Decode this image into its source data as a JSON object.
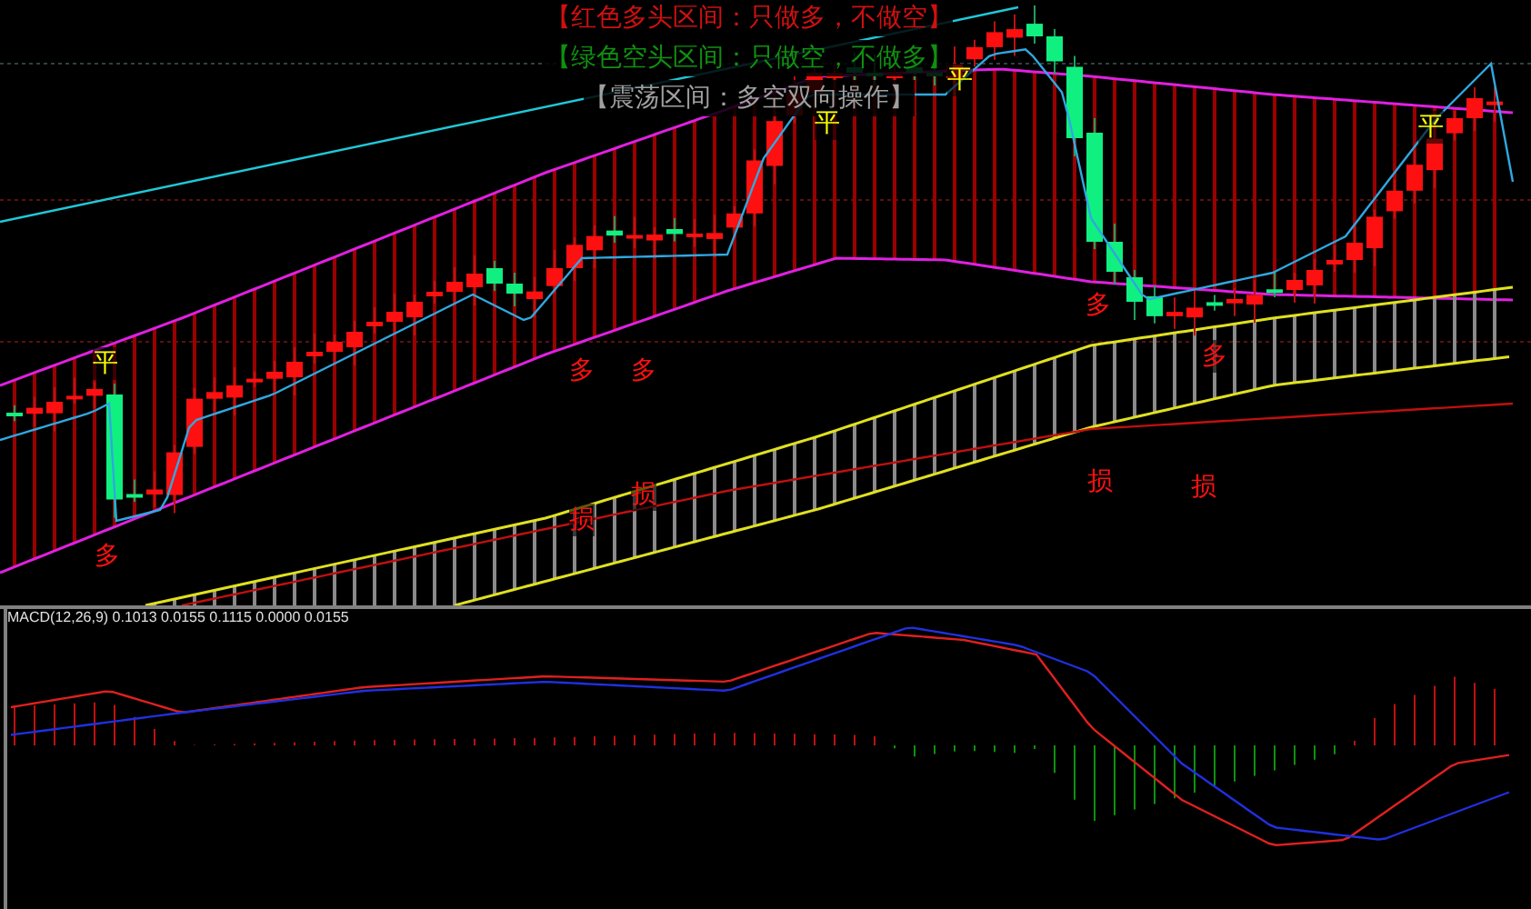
{
  "legend": [
    {
      "text": "【红色多头区间：只做多，不做空】",
      "kind": "bull"
    },
    {
      "text": "【绿色空头区间：只做空，不做多】",
      "kind": "bear"
    },
    {
      "text": "【震荡区间：多空双向操作】",
      "kind": "range"
    }
  ],
  "markers": [
    {
      "text": "平",
      "kind": "flat"
    },
    {
      "text": "平",
      "kind": "flat"
    },
    {
      "text": "平",
      "kind": "flat"
    },
    {
      "text": "平",
      "kind": "flat"
    },
    {
      "text": "多",
      "kind": "long"
    },
    {
      "text": "多",
      "kind": "long"
    },
    {
      "text": "多",
      "kind": "long"
    },
    {
      "text": "多",
      "kind": "long"
    },
    {
      "text": "多",
      "kind": "long"
    },
    {
      "text": "损",
      "kind": "stop"
    },
    {
      "text": "损",
      "kind": "stop"
    },
    {
      "text": "损",
      "kind": "stop"
    },
    {
      "text": "损",
      "kind": "stop"
    }
  ],
  "macd": {
    "label": "MACD(12,26,9) 0.1013 0.0155 0.1115 0.0000 0.0155"
  }
}
